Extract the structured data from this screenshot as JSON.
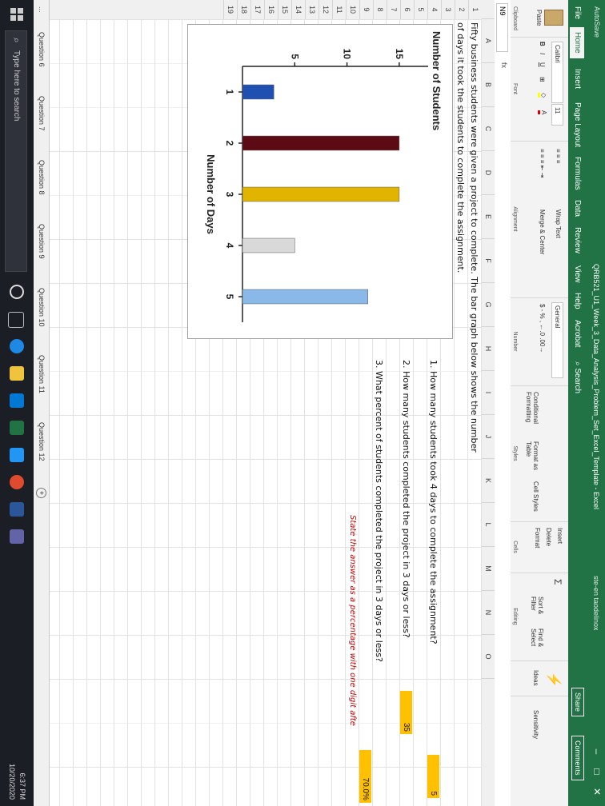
{
  "window": {
    "autosave_label": "AutoSave",
    "title": "QRB521_U1_Week_3_Data_Analysis_Problem_Set_Excel_Template - Excel",
    "user": "ste-en taodelinox"
  },
  "ribbon_tabs": [
    "File",
    "Home",
    "Insert",
    "Page Layout",
    "Formulas",
    "Data",
    "Review",
    "View",
    "Help",
    "Acrobat"
  ],
  "ribbon_search": "Search",
  "share_label": "Share",
  "comments_label": "Comments",
  "ribbon": {
    "paste": "Paste",
    "clipboard": "Clipboard",
    "font_name": "Calibri",
    "font_size": "11",
    "font_group": "Font",
    "alignment_group": "Alignment",
    "wrap_text": "Wrap Text",
    "merge_center": "Merge & Center",
    "number_format": "General",
    "number_group": "Number",
    "conditional_formatting": "Conditional Formatting",
    "format_as_table": "Format as Table",
    "cell_styles": "Cell Styles",
    "styles_group": "Styles",
    "insert": "Insert",
    "delete": "Delete",
    "format": "Format",
    "cells_group": "Cells",
    "sort_filter": "Sort & Filter",
    "find_select": "Find & Select",
    "editing_group": "Editing",
    "ideas": "Ideas",
    "sensitivity": "Sensitivity"
  },
  "name_box": "N9",
  "formula_fx": "fx",
  "columns": [
    "A",
    "B",
    "C",
    "D",
    "E",
    "F",
    "G",
    "H",
    "I",
    "J",
    "K",
    "L",
    "M",
    "N",
    "O"
  ],
  "rows": [
    "1",
    "2",
    "3",
    "4",
    "5",
    "6",
    "7",
    "8",
    "9",
    "10",
    "11",
    "12",
    "13",
    "14",
    "15",
    "16",
    "17",
    "18",
    "19"
  ],
  "sheet": {
    "intro_line1": "Fifty business students were given a project to complete. The bar graph below shows the number",
    "intro_line2": "of days it took the students to complete the assignment.",
    "q1": "1. How many students took 4 days to complete the assignment?",
    "a1": "5",
    "q2": "2. How many students completed the project in 3 days or less?",
    "a2": "35",
    "q3": "3. What percent of students completed the project in 3 days or less?",
    "a3": "70.0%",
    "q3_note": "State the answer as a percentage with one digit afte"
  },
  "chart_data": {
    "type": "bar",
    "xlabel": "Number of Days",
    "ylabel": "Number of Students",
    "categories": [
      "1",
      "2",
      "3",
      "4",
      "5"
    ],
    "values": [
      3,
      15,
      15,
      5,
      12
    ],
    "colors": [
      "#1f4fb0",
      "#5c0a14",
      "#e0b400",
      "#d9d9d9",
      "#8ab8e8"
    ],
    "y_ticks": [
      "5",
      "10",
      "15"
    ],
    "ylim": [
      0,
      17
    ],
    "grid": false
  },
  "sheet_tabs": [
    "...",
    "Question 6",
    "Question 7",
    "Question 8",
    "Question 9",
    "Question 10",
    "Question 11",
    "Question 12"
  ],
  "taskbar": {
    "search_placeholder": "Type here to search",
    "time": "6:37 PM",
    "date": "10/20/2020"
  }
}
